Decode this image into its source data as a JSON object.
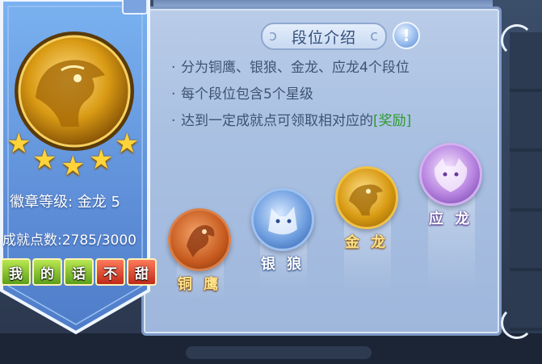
{
  "panel": {
    "title": "段位介绍",
    "help_icon": "question-icon",
    "rules": [
      "分为铜鹰、银狼、金龙、应龙4个段位",
      "每个段位包含5个星级",
      "达到一定成就点可领取相对应的"
    ],
    "reward_text": "[奖励]",
    "reward_color": "#2f9a2f"
  },
  "ranks": [
    {
      "label": "铜 鹰",
      "icon": "eagle-icon",
      "color": "#c65a1e"
    },
    {
      "label": "银 狼",
      "icon": "wolf-icon",
      "color": "#3a6fc6"
    },
    {
      "label": "金 龙",
      "icon": "dragon-icon",
      "color": "#d89a12"
    },
    {
      "label": "应 龙",
      "icon": "dragon-head-icon",
      "color": "#9a5ac8"
    }
  ],
  "badge": {
    "medal_icon": "gold-dragon-medal-icon",
    "stars": 5,
    "stars_max": 5,
    "level_label": "徽章等级: 金龙 5",
    "points_label": "成就点数:2785/3000",
    "tags": [
      "我",
      "的",
      "话",
      "不",
      "甜"
    ],
    "edit_icon": "edit-icon"
  },
  "colors": {
    "panel_bg": "#a9c0e2",
    "banner_bg": "#5f8fd8",
    "title_text": "#35507d",
    "rule_text": "#3e5372"
  }
}
